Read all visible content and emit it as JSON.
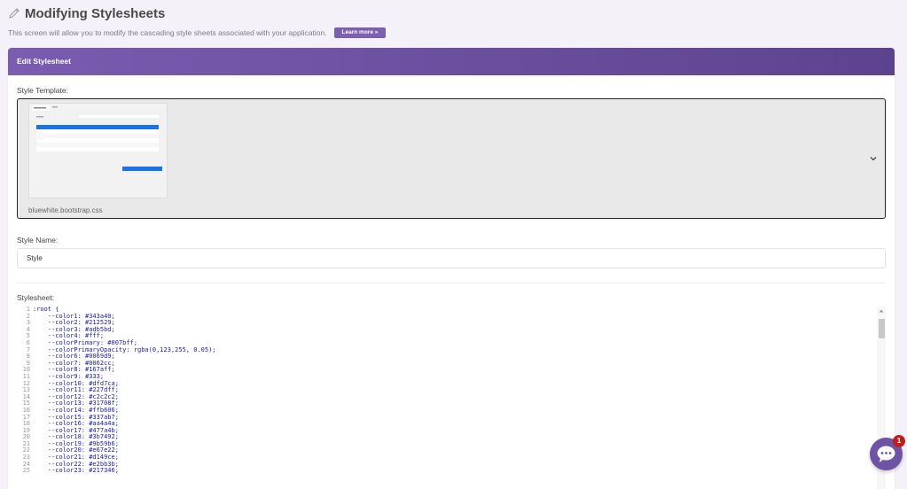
{
  "header": {
    "title": "Modifying Stylesheets",
    "subtitle": "This screen will allow you to modify the cascading style sheets associated with your application.",
    "learn_more": "Learn more »",
    "icon": "pencil-icon"
  },
  "panel": {
    "title": "Edit Stylesheet",
    "template_label": "Style Template:",
    "template_value": "bluewhite.bootstrap.css",
    "style_name_label": "Style Name:",
    "style_name_value": "Style",
    "stylesheet_label": "Stylesheet:"
  },
  "code_lines": [
    {
      "n": "1",
      "t": ":root {"
    },
    {
      "n": "2",
      "t": "    --color1: #343a40;"
    },
    {
      "n": "3",
      "t": "    --color2: #212529;"
    },
    {
      "n": "4",
      "t": "    --color3: #adb5bd;"
    },
    {
      "n": "5",
      "t": "    --color4: #fff;"
    },
    {
      "n": "6",
      "t": "    --colorPrimary: #007bff;"
    },
    {
      "n": "7",
      "t": "    --colorPrimaryOpacity: rgba(0,123,255, 0.05);"
    },
    {
      "n": "8",
      "t": "    --color6: #0069d9;"
    },
    {
      "n": "9",
      "t": "    --color7: #0062cc;"
    },
    {
      "n": "10",
      "t": "    --color8: #167aff;"
    },
    {
      "n": "11",
      "t": "    --color9: #333;"
    },
    {
      "n": "12",
      "t": "    --color10: #dfd7ca;"
    },
    {
      "n": "13",
      "t": "    --color11: #227dff;"
    },
    {
      "n": "14",
      "t": "    --color12: #c2c2c2;"
    },
    {
      "n": "15",
      "t": "    --color13: #31708f;"
    },
    {
      "n": "16",
      "t": "    --color14: #ffb606;"
    },
    {
      "n": "17",
      "t": "    --color15: #337ab7;"
    },
    {
      "n": "18",
      "t": "    --color16: #aa4a4a;"
    },
    {
      "n": "19",
      "t": "    --color17: #477a4b;"
    },
    {
      "n": "20",
      "t": "    --color18: #3b7492;"
    },
    {
      "n": "21",
      "t": "    --color19: #9b59b6;"
    },
    {
      "n": "22",
      "t": "    --color20: #e67e22;"
    },
    {
      "n": "23",
      "t": "    --color21: #d149ce;"
    },
    {
      "n": "24",
      "t": "    --color22: #e2bb3b;"
    },
    {
      "n": "25",
      "t": "    --color23: #217346;"
    }
  ],
  "chat": {
    "badge": "1"
  },
  "colors": {
    "accent": "#7b5fb3",
    "header_from": "#7a5cb0",
    "header_to": "#5d438f"
  }
}
